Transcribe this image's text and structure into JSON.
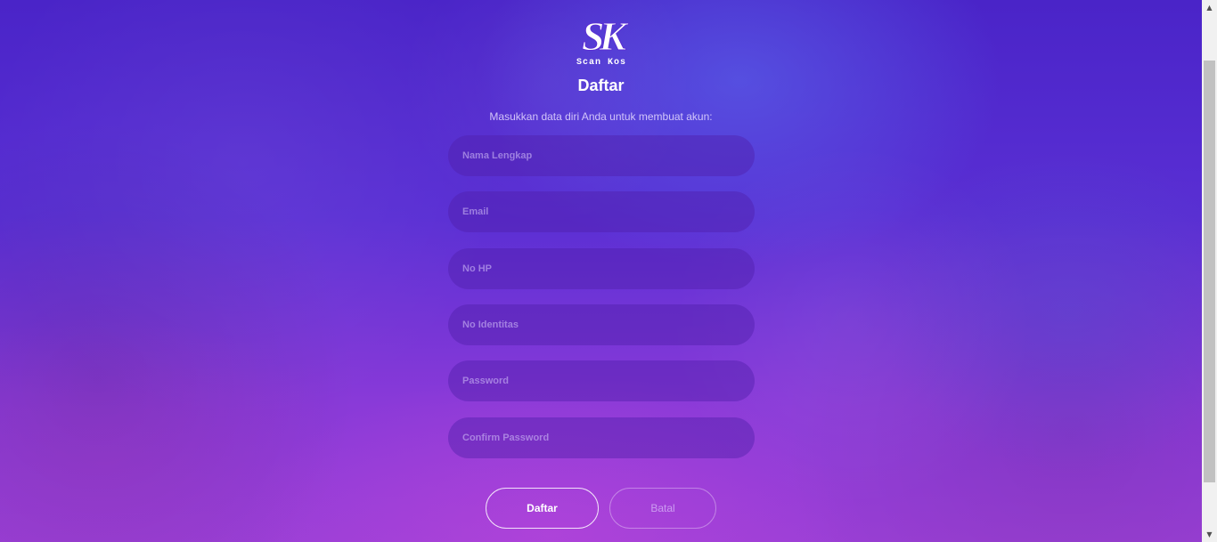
{
  "logo": {
    "letters": "SK",
    "tagline": "Scan Kos"
  },
  "form": {
    "title": "Daftar",
    "subtitle": "Masukkan data diri Anda untuk membuat akun:",
    "fields": {
      "full_name": {
        "placeholder": "Nama Lengkap",
        "value": ""
      },
      "email": {
        "placeholder": "Email",
        "value": ""
      },
      "phone": {
        "placeholder": "No HP",
        "value": ""
      },
      "identity": {
        "placeholder": "No Identitas",
        "value": ""
      },
      "password": {
        "placeholder": "Password",
        "value": ""
      },
      "confirm_password": {
        "placeholder": "Confirm Password",
        "value": ""
      }
    },
    "submit_label": "Daftar",
    "cancel_label": "Batal"
  },
  "scrollbar": {
    "up_icon": "▲",
    "down_icon": "▼"
  },
  "colors": {
    "background_top": "#4a24c8",
    "background_bottom": "#9a3fd6",
    "field_fill": "#5a2aa8",
    "text": "#ffffff"
  }
}
